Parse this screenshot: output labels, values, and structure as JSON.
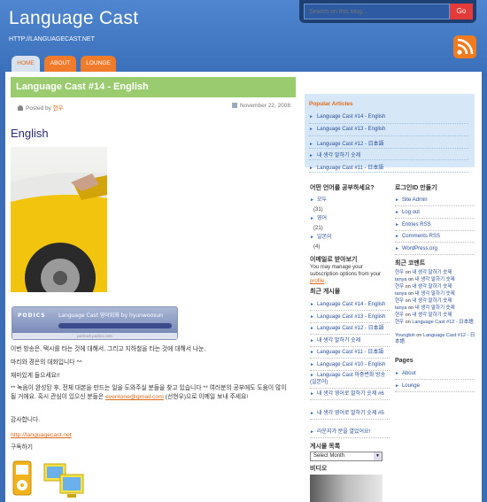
{
  "header": {
    "title": "Language Cast",
    "url": "HTTP://LANGUAGECAST.NET"
  },
  "search": {
    "placeholder": "Search on this blog...",
    "go_label": "Go"
  },
  "icons": {
    "rss": "rss-icon",
    "author": "user-icon",
    "date": "calendar-icon"
  },
  "colors": {
    "accent": "#f07b2a",
    "brand_blue": "#3a6db5",
    "title_green": "#9acb6f"
  },
  "tabs": [
    {
      "label": "HOME"
    },
    {
      "label": "ABOUT"
    },
    {
      "label": "LOUNGE"
    }
  ],
  "post": {
    "title": "Language Cast #14 - English",
    "posted_by_label": "Posted by",
    "author": "현우",
    "date": "November 22, 2008",
    "heading": "English",
    "player": {
      "brand": "PODICS",
      "title": "Language Cast 영어회화 by hyunwoosun",
      "footer": "podcast.podics.com"
    },
    "body": [
      "이번 방송은, 택시를 타는 것에 대해서, 그리고 지하철을 타는 것에 대해서 나눈,",
      "마리와 경은의 대화입니다 ^^",
      "재미있게 들으세요!!",
      "** 녹음이 완성된 후, 전체 대본을 만드는 일을 도와주실 분들을 찾고 있습니다 ** 여러분의 공부에도 도움이 많이 될 거에요. 혹시 관심이 있으신 분들은 ",
      "eventone@gmail.com",
      " (선현우)으로 이메일 보내 주세요!",
      "감사합니다.",
      "http://languagecast.net",
      "구독하기"
    ]
  },
  "sidebar": {
    "popular": {
      "title": "Popular Articles",
      "items": [
        "Language Cast #14 - English",
        "Language Cast #13 - English",
        "Language Cast #12 - 日本語",
        "내 생각 말하기 숫제",
        "Language Cast #11 - 日本語"
      ]
    },
    "cats": {
      "title": "어떤 언어를 공부하세요?",
      "items": [
        "모두",
        "(31)",
        "영어",
        "(21)",
        "일본어",
        "(4)"
      ]
    },
    "subscribe": {
      "title": "이메일로 받아보기",
      "text": "You may manage your subscription options from your ",
      "link": "profile",
      "end": "."
    },
    "recent_posts": {
      "title": "최근 게시물",
      "items": [
        "Language Cast #14 - English",
        "Language Cast #13 - English",
        "Language Cast #12 - 日本語",
        "내 생각 말하기 숫제",
        "Language Cast #11 - 日本語",
        "Language Cast #10 - English",
        "Language Cast 마중변화 방송 (일본어)",
        "내 생각 영어로 말하기 숫제 #6",
        "내 생각 영어로 말하기 숫제 #5",
        "라운지가 문을 열었어요!"
      ]
    },
    "archive": {
      "title": "게시물 목록",
      "select": "Select Month"
    },
    "video": {
      "title": "비디오"
    },
    "meta": {
      "title": "로그인ID 만들기",
      "items": [
        "Site Admin",
        "Log out",
        "Entries RSS",
        "Comments RSS",
        "WordPress.org"
      ]
    },
    "recent_comments": {
      "title": "최근 코멘트",
      "items": [
        [
          "현우",
          " on ",
          "내 생각 말하기 숫제"
        ],
        [
          "tanya",
          " on ",
          "내 생각 말하기 숫제"
        ],
        [
          "현우",
          " on ",
          "내 생각 말하기 숫제"
        ],
        [
          "tanya",
          " on ",
          "내 생각 말하기 숫제"
        ],
        [
          "현우",
          " on ",
          "내 생각 말하기 숫제"
        ],
        [
          "tanya",
          " on ",
          "내 생각 말하기 숫제"
        ],
        [
          "현우",
          " on ",
          "내 생각 말하기 숫제"
        ],
        [
          "현우",
          " on ",
          "Language Cast #12 - 日本語"
        ],
        [
          "Youngbin",
          " on ",
          "Language Cast #12 - 日本語"
        ]
      ]
    },
    "pages": {
      "title": "Pages",
      "items": [
        "About",
        "Lounge"
      ]
    }
  }
}
